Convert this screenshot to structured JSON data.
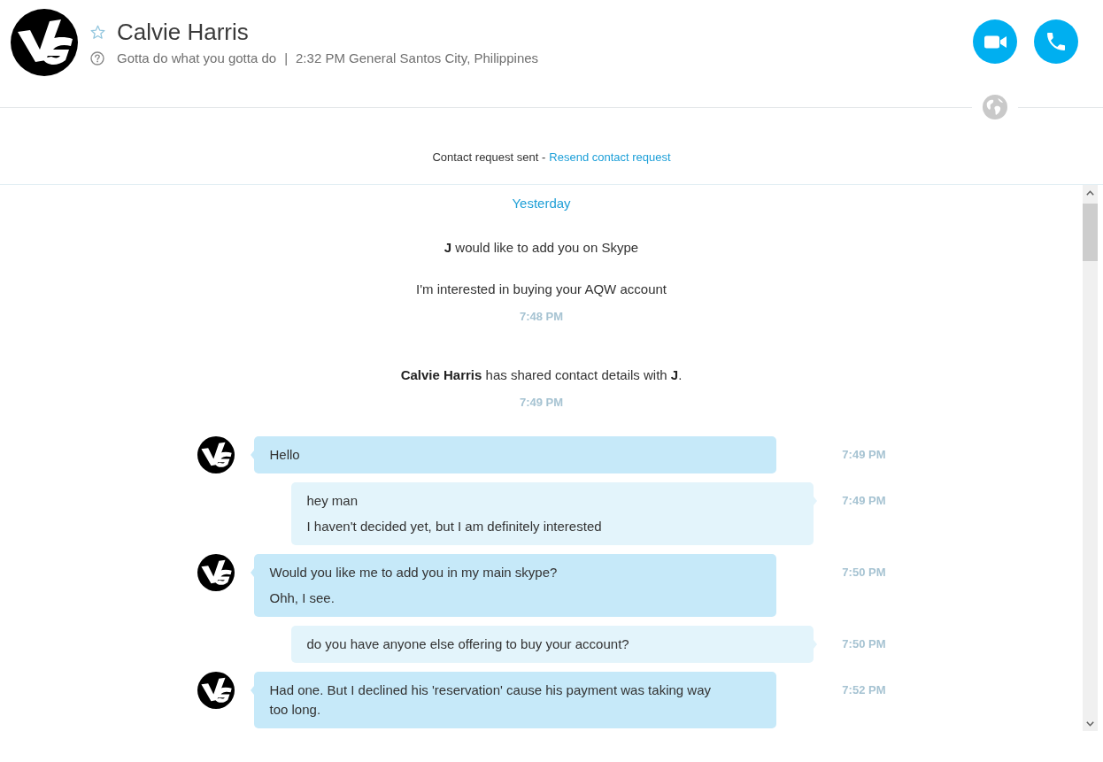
{
  "header": {
    "name": "Calvie Harris",
    "mood": "Gotta do what you gotta do",
    "separator": "|",
    "local_time": "2:32 PM General Santos City, Philippines"
  },
  "contact_request": {
    "status": "Contact request sent -",
    "action": "Resend contact request"
  },
  "conversation": {
    "date": "Yesterday",
    "events": [
      {
        "lines": [
          "**J** would like to add you on Skype",
          "I'm interested in buying your AQW account"
        ],
        "time": "7:48 PM"
      },
      {
        "lines": [
          "**Calvie Harris** has shared contact details with **J**."
        ],
        "time": "7:49 PM"
      }
    ],
    "messages": [
      {
        "kind": "incoming",
        "lines": [
          "Hello"
        ],
        "time": "7:49 PM"
      },
      {
        "kind": "outgoing",
        "lines": [
          "hey man",
          "I haven't decided yet, but I am definitely interested"
        ],
        "time": "7:49 PM"
      },
      {
        "kind": "incoming",
        "lines": [
          "Would you like me to add you in my main skype?",
          "Ohh, I see."
        ],
        "time": "7:50 PM"
      },
      {
        "kind": "outgoing",
        "lines": [
          "do you have anyone else offering to buy your account?"
        ],
        "time": "7:50 PM"
      },
      {
        "kind": "incoming",
        "lines": [
          "Had one. But I declined his 'reservation' cause his payment was taking way too long."
        ],
        "time": "7:52 PM"
      }
    ]
  }
}
